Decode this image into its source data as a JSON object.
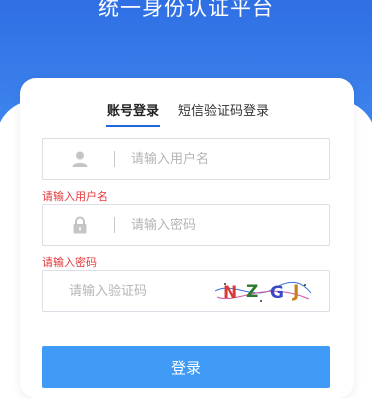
{
  "page": {
    "title": "统一身份认证平台",
    "brand_color": "#2f6fe4",
    "error_color": "#e4393c",
    "button_color": "#3f9bf5"
  },
  "tabs": [
    {
      "label": "账号登录",
      "active": true
    },
    {
      "label": "短信验证码登录",
      "active": false
    }
  ],
  "form": {
    "username": {
      "placeholder": "请输入用户名",
      "value": "",
      "icon": "user-icon",
      "error": "请输入用户名"
    },
    "password": {
      "placeholder": "请输入密码",
      "value": "",
      "icon": "lock-icon",
      "error": "请输入密码"
    },
    "captcha": {
      "placeholder": "请输入验证码",
      "value": "",
      "image_text": "NZGJ"
    }
  },
  "login_button": {
    "label": "登录"
  }
}
